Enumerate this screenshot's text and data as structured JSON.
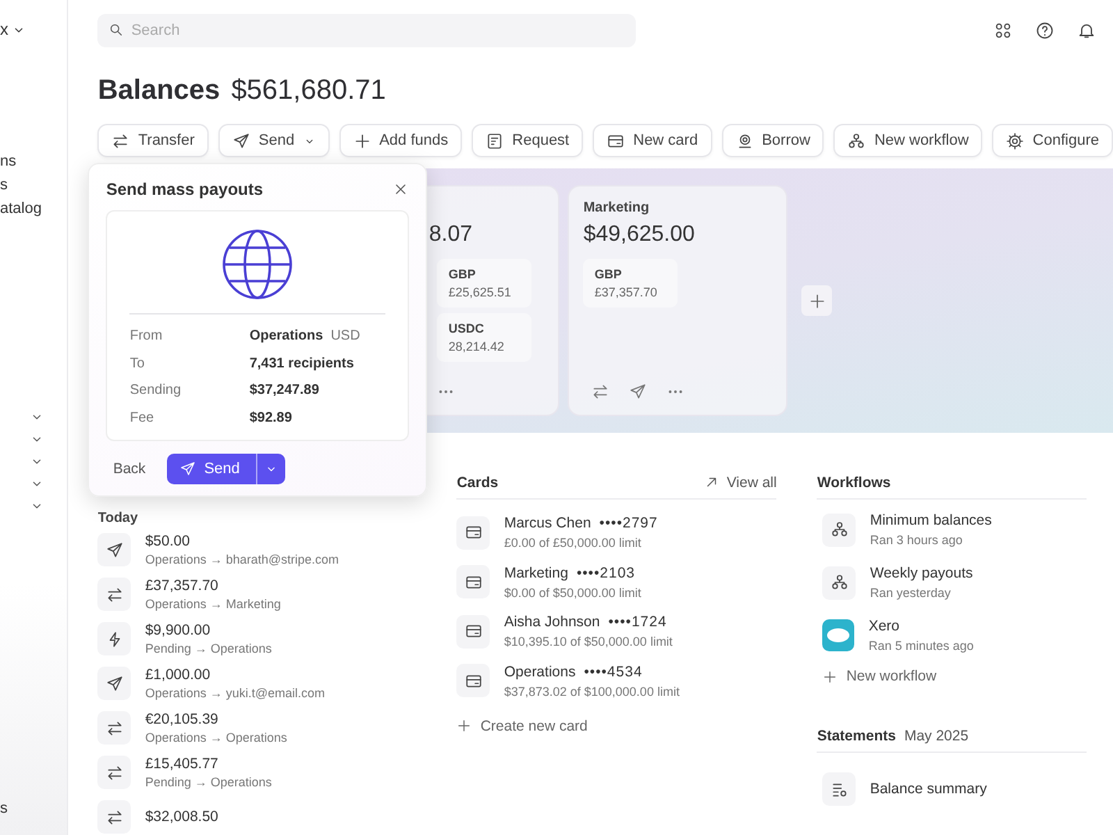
{
  "sidebar": {
    "workspace": {
      "label": "x"
    },
    "items": [
      {
        "label": "ns"
      },
      {
        "label": "s"
      },
      {
        "label": "atalog"
      }
    ],
    "sections": [
      {
        "expanded": false
      },
      {
        "expanded": false
      },
      {
        "expanded": false
      },
      {
        "expanded": false
      },
      {
        "expanded": false
      }
    ],
    "footer_item": {
      "label": "s"
    }
  },
  "topbar": {
    "search": {
      "placeholder": "Search"
    }
  },
  "header": {
    "title": "Balances",
    "total": "$561,680.71"
  },
  "actions": [
    {
      "kind": "transfer",
      "label": "Transfer",
      "has_menu": false
    },
    {
      "kind": "send",
      "label": "Send",
      "has_menu": true
    },
    {
      "kind": "plus",
      "label": "Add funds",
      "has_menu": false
    },
    {
      "kind": "request",
      "label": "Request",
      "has_menu": false
    },
    {
      "kind": "card",
      "label": "New card",
      "has_menu": false
    },
    {
      "kind": "borrow",
      "label": "Borrow",
      "has_menu": false
    },
    {
      "kind": "workflow",
      "label": "New workflow",
      "has_menu": false
    },
    {
      "kind": "gear",
      "label": "Configure",
      "has_menu": false
    }
  ],
  "accounts": [
    {
      "amount": "8.07",
      "balances": [
        {
          "currency": "GBP",
          "amount": "£25,625.51"
        },
        {
          "currency": "USDC",
          "amount": "28,214.42"
        }
      ]
    },
    {
      "name": "Marketing",
      "amount": "$49,625.00",
      "balances": [
        {
          "currency": "GBP",
          "amount": "£37,357.70"
        }
      ]
    }
  ],
  "modal": {
    "title": "Send mass payouts",
    "rows": [
      {
        "label": "From",
        "value": "Operations",
        "extra": "USD"
      },
      {
        "label": "To",
        "value": "7,431 recipients"
      },
      {
        "label": "Sending",
        "value": "$37,247.89"
      },
      {
        "label": "Fee",
        "value": "$92.89"
      }
    ],
    "back": "Back",
    "send": "Send"
  },
  "transactions": {
    "heading": "Today",
    "items": [
      {
        "kind": "send",
        "amount": "$50.00",
        "route": "Operations → bharath@stripe.com"
      },
      {
        "kind": "transfer",
        "amount": "£37,357.70",
        "route": "Operations → Marketing"
      },
      {
        "kind": "bolt",
        "amount": "$9,900.00",
        "route": "Pending → Operations"
      },
      {
        "kind": "send",
        "amount": "£1,000.00",
        "route": "Operations → yuki.t@email.com"
      },
      {
        "kind": "transfer",
        "amount": "€20,105.39",
        "route": "Operations → Operations"
      },
      {
        "kind": "transfer",
        "amount": "£15,405.77",
        "route": "Pending → Operations"
      },
      {
        "kind": "transfer",
        "amount": "$32,008.50"
      }
    ]
  },
  "cards": {
    "heading": "Cards",
    "view_all": "View all",
    "items": [
      {
        "name": "Marcus Chen",
        "number": "••••2797",
        "limit": "£0.00 of £50,000.00 limit"
      },
      {
        "name": "Marketing",
        "number": "••••2103",
        "limit": "$0.00 of $50,000.00 limit"
      },
      {
        "name": "Aisha Johnson",
        "number": "••••1724",
        "limit": "$10,395.10 of $50,000.00 limit"
      },
      {
        "name": "Operations",
        "number": "••••4534",
        "limit": "$37,873.02 of $100,000.00 limit"
      }
    ],
    "create": "Create new card"
  },
  "workflows": {
    "heading": "Workflows",
    "items": [
      {
        "kind": "workflow",
        "name": "Minimum balances",
        "status": "Ran 3 hours ago"
      },
      {
        "kind": "workflow",
        "name": "Weekly payouts",
        "status": "Ran yesterday"
      },
      {
        "kind": "app",
        "name": "Xero",
        "status": "Ran 5 minutes ago"
      }
    ],
    "create": "New workflow"
  },
  "statements": {
    "title": "Statements",
    "period": "May 2025",
    "items": [
      {
        "label": "Balance summary"
      }
    ]
  }
}
